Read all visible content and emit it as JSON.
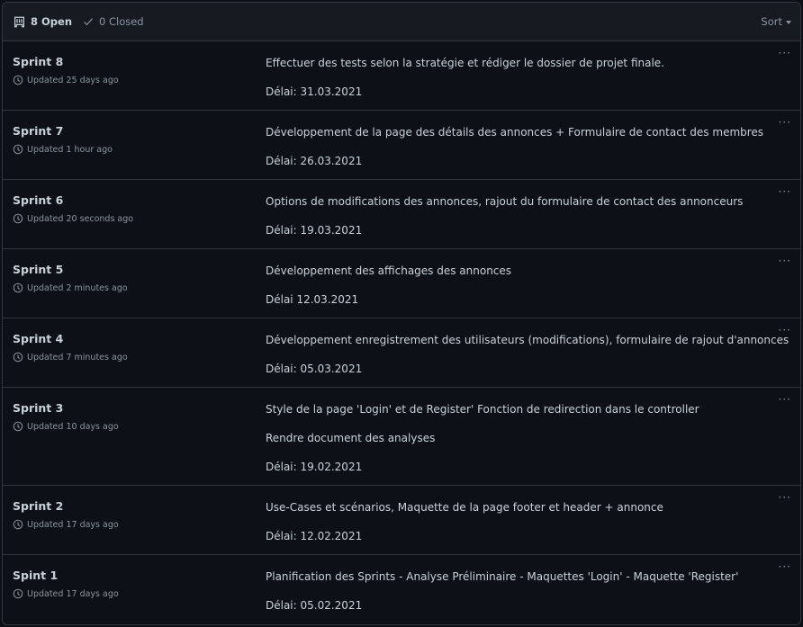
{
  "header": {
    "open_label": "8 Open",
    "closed_label": "0 Closed",
    "sort_label": "Sort"
  },
  "milestones": [
    {
      "title": "Sprint 8",
      "updated": "Updated 25 days ago",
      "lines": [
        "Effectuer des tests selon la stratégie et rédiger le dossier de projet finale.",
        "Délai: 31.03.2021"
      ]
    },
    {
      "title": "Sprint 7",
      "updated": "Updated 1 hour ago",
      "lines": [
        "Développement de la page des détails des annonces + Formulaire de contact des membres",
        "Délai: 26.03.2021"
      ]
    },
    {
      "title": "Sprint 6",
      "updated": "Updated 20 seconds ago",
      "lines": [
        "Options de modifications des annonces, rajout du formulaire de contact des annonceurs",
        "Délai: 19.03.2021"
      ]
    },
    {
      "title": "Sprint 5",
      "updated": "Updated 2 minutes ago",
      "lines": [
        "Développement des affichages des annonces",
        "Délai 12.03.2021"
      ]
    },
    {
      "title": "Sprint 4",
      "updated": "Updated 7 minutes ago",
      "lines": [
        "Développement enregistrement des utilisateurs (modifications), formulaire de rajout d'annonces",
        "Délai: 05.03.2021"
      ]
    },
    {
      "title": "Sprint 3",
      "updated": "Updated 10 days ago",
      "lines": [
        "Style de la page 'Login' et de Register' Fonction de redirection dans le controller",
        "Rendre document des analyses",
        "Délai: 19.02.2021"
      ]
    },
    {
      "title": "Sprint 2",
      "updated": "Updated 17 days ago",
      "lines": [
        "Use-Cases et scénarios, Maquette de la page footer et header + annonce",
        "Délai: 12.02.2021"
      ]
    },
    {
      "title": "Spint 1",
      "updated": "Updated 17 days ago",
      "lines": [
        "Planification des Sprints - Analyse Préliminaire - Maquettes 'Login' - Maquette 'Register'",
        "Délai: 05.02.2021"
      ]
    }
  ],
  "more_label": "···"
}
